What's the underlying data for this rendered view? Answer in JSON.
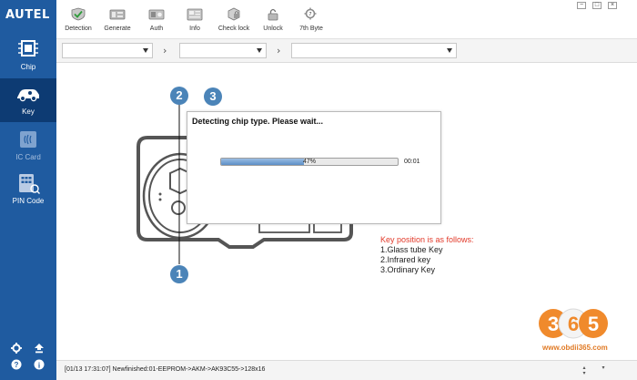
{
  "app": {
    "brand": "AUTEL"
  },
  "sidebar": {
    "items": [
      {
        "label": "Chip",
        "icon": "chip-icon",
        "state": "normal"
      },
      {
        "label": "Key",
        "icon": "car-key-icon",
        "state": "active"
      },
      {
        "label": "IC Card",
        "icon": "ic-card-icon",
        "state": "disabled"
      },
      {
        "label": "PIN Code",
        "icon": "pin-code-icon",
        "state": "normal"
      }
    ],
    "bottom_icons": [
      "settings-icon",
      "upload-icon",
      "help-icon",
      "info-icon"
    ]
  },
  "toolbar": {
    "items": [
      {
        "label": "Detection",
        "icon": "detection-icon"
      },
      {
        "label": "Generate",
        "icon": "generate-icon"
      },
      {
        "label": "Auth",
        "icon": "auth-icon"
      },
      {
        "label": "Info",
        "icon": "info-card-icon"
      },
      {
        "label": "Check lock",
        "icon": "check-lock-icon"
      },
      {
        "label": "Unlock",
        "icon": "unlock-icon"
      },
      {
        "label": "7th Byte",
        "icon": "seventh-byte-icon"
      }
    ]
  },
  "window_controls": [
    "minimize",
    "maximize",
    "close"
  ],
  "selectors": [
    {
      "value": ""
    },
    {
      "value": ""
    },
    {
      "value": ""
    }
  ],
  "markers": [
    "1",
    "2",
    "3"
  ],
  "dialog": {
    "title": "Detecting chip type. Please wait...",
    "progress": 0.47,
    "progress_label": "47%",
    "elapsed": "00:01"
  },
  "key_info": {
    "heading": "Key position is as follows:",
    "lines": [
      "1.Glass tube Key",
      "2.Infrared key",
      "3.Ordinary Key"
    ]
  },
  "watermark": {
    "number": "365",
    "url": "www.obdii365.com"
  },
  "status": {
    "message": "[01/13 17:31:07] Newfinished:01-EEPROM->AKM->AK93C55->128x16"
  },
  "colors": {
    "sidebar": "#1f5ba0",
    "sidebar_active": "#0d3b73",
    "marker": "#4b84b8",
    "progress_fill": "#5d8fc7",
    "key_info_heading": "#e23a2a"
  }
}
